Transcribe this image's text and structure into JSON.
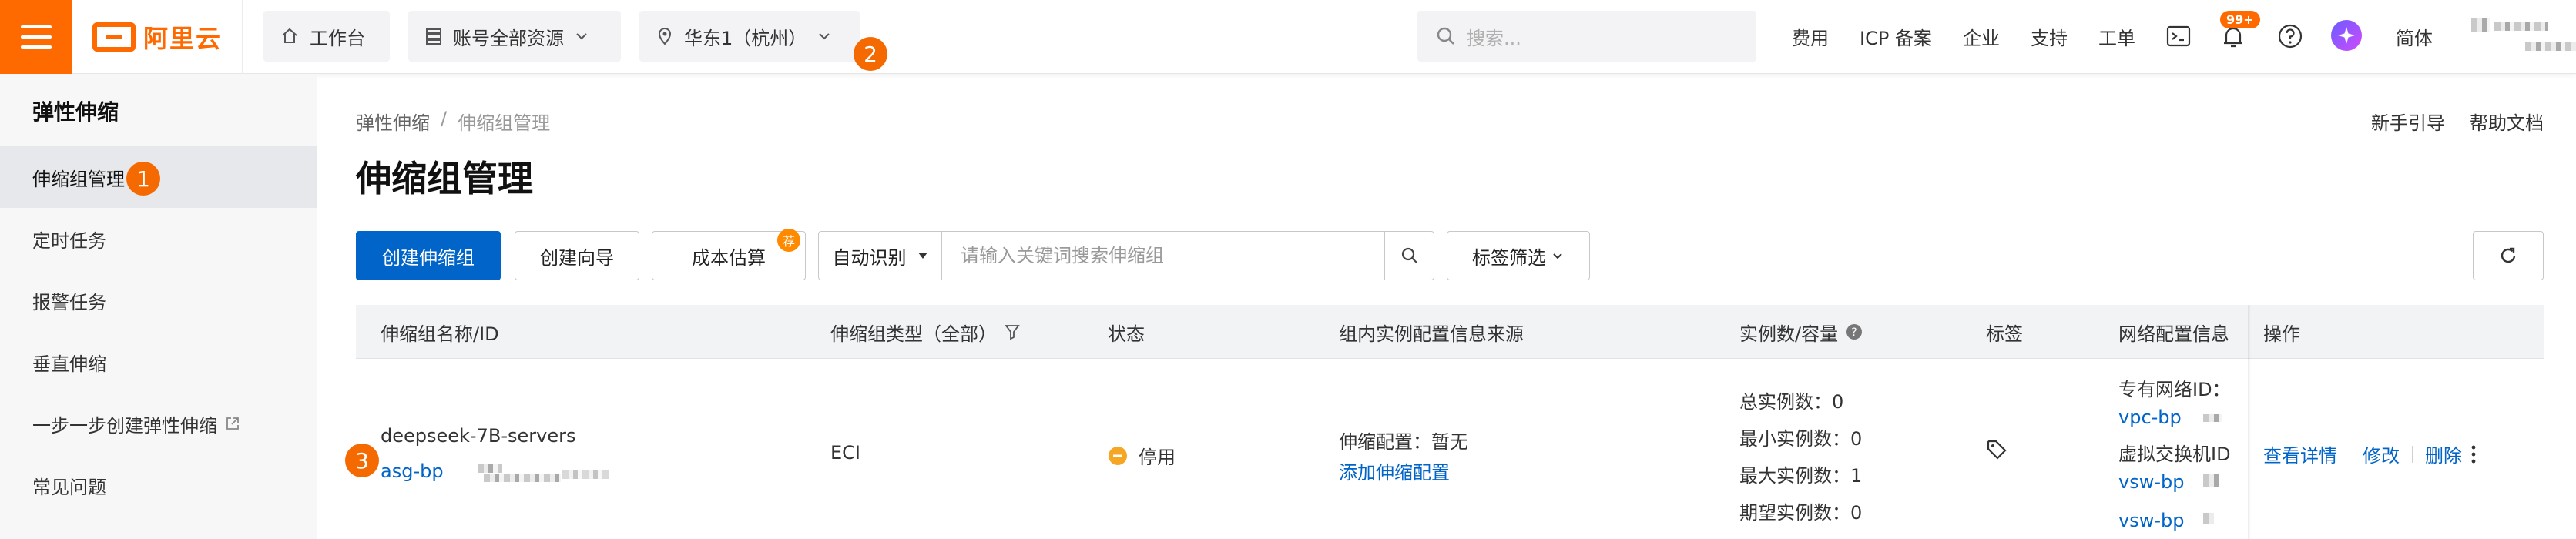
{
  "topbar": {
    "brand": "阿里云",
    "workbench": "工作台",
    "resources": "账号全部资源",
    "region": "华东1（杭州）",
    "search_placeholder": "搜索...",
    "nav": [
      "费用",
      "ICP 备案",
      "企业",
      "支持",
      "工单"
    ],
    "notify_badge": "99+",
    "lang": "简体"
  },
  "markers": [
    "1",
    "2",
    "3"
  ],
  "sidebar": {
    "title": "弹性伸缩",
    "items": [
      {
        "label": "伸缩组管理",
        "active": true
      },
      {
        "label": "定时任务"
      },
      {
        "label": "报警任务"
      },
      {
        "label": "垂直伸缩"
      },
      {
        "label": "一步一步创建弹性伸缩"
      },
      {
        "label": "常见问题"
      }
    ]
  },
  "breadcrumb": {
    "root": "弹性伸缩",
    "sep": "/",
    "current": "伸缩组管理"
  },
  "page_title": "伸缩组管理",
  "header_links": {
    "guide": "新手引导",
    "docs": "帮助文档"
  },
  "toolbar": {
    "create": "创建伸缩组",
    "wizard": "创建向导",
    "cost": "成本估算",
    "cost_badge": "荐",
    "auto_detect": "自动识别",
    "search_placeholder": "请输入关键词搜索伸缩组",
    "tag_filter": "标签筛选"
  },
  "table": {
    "columns": [
      "伸缩组名称/ID",
      "伸缩组类型（全部）",
      "状态",
      "组内实例配置信息来源",
      "实例数/容量",
      "标签",
      "网络配置信息",
      "操作"
    ],
    "row": {
      "name": "deepseek-7B-servers",
      "id_prefix": "asg-bp",
      "type": "ECI",
      "status": "停用",
      "config_label": "伸缩配置：暂无",
      "config_add": "添加伸缩配置",
      "capacity": [
        "总实例数：0",
        "最小实例数：0",
        "最大实例数：1",
        "期望实例数：0"
      ],
      "network_vpc_label": "专有网络ID：",
      "network_vpc_value": "vpc-bp",
      "network_vsw_label": "虚拟交换机ID",
      "network_vsw_values": [
        "vsw-bp",
        "vsw-bp"
      ],
      "actions": [
        "查看详情",
        "修改",
        "删除"
      ]
    }
  },
  "colors": {
    "brand": "#ff6a00",
    "primary": "#0064c8",
    "status_stopped": "#f5a623"
  }
}
